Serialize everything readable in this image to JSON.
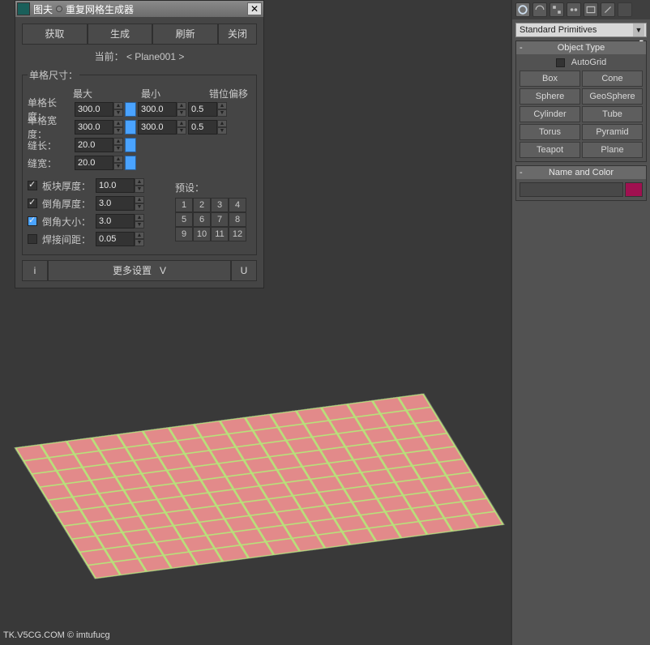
{
  "dialog": {
    "title1": "图夫",
    "title2": "重复网格生成器",
    "buttons": {
      "get": "获取",
      "gen": "生成",
      "refresh": "刷新",
      "close": "关闭"
    },
    "current_label": "当前：",
    "current_value": "< Plane001 >",
    "group_label": "单格尺寸：",
    "cols": {
      "max": "最大",
      "min": "最小",
      "offset": "错位偏移"
    },
    "rows": {
      "len": {
        "label": "单格长度：",
        "max": "300.0",
        "min": "300.0",
        "off": "0.5"
      },
      "wid": {
        "label": "单格宽度：",
        "max": "300.0",
        "min": "300.0",
        "off": "0.5"
      },
      "seamL": {
        "label": "缝长：",
        "val": "20.0"
      },
      "seamW": {
        "label": "缝宽：",
        "val": "20.0"
      }
    },
    "checks": {
      "thick": {
        "label": "板块厚度：",
        "val": "10.0",
        "checked": true
      },
      "chamferT": {
        "label": "倒角厚度：",
        "val": "3.0",
        "checked": true
      },
      "chamferS": {
        "label": "倒角大小：",
        "val": "3.0",
        "checked": true,
        "blue": true
      },
      "weld": {
        "label": "焊接间距：",
        "val": "0.05",
        "checked": false
      }
    },
    "presets_label": "预设：",
    "presets": [
      "1",
      "2",
      "3",
      "4",
      "5",
      "6",
      "7",
      "8",
      "9",
      "10",
      "11",
      "12"
    ],
    "bottom": {
      "i": "i",
      "more": "更多设置",
      "v": "V",
      "u": "U"
    }
  },
  "panel": {
    "category": "Standard Primitives",
    "object_type": "Object Type",
    "autogrid": "AutoGrid",
    "prims": [
      "Box",
      "Cone",
      "Sphere",
      "GeoSphere",
      "Cylinder",
      "Tube",
      "Torus",
      "Pyramid",
      "Teapot",
      "Plane"
    ],
    "name_and_color": "Name and Color"
  },
  "watermark": "TK.V5CG.COM © imtufucg",
  "colors": {
    "tile": "#e28a8a",
    "grout": "#b8e07a",
    "swatch": "#a01050"
  }
}
